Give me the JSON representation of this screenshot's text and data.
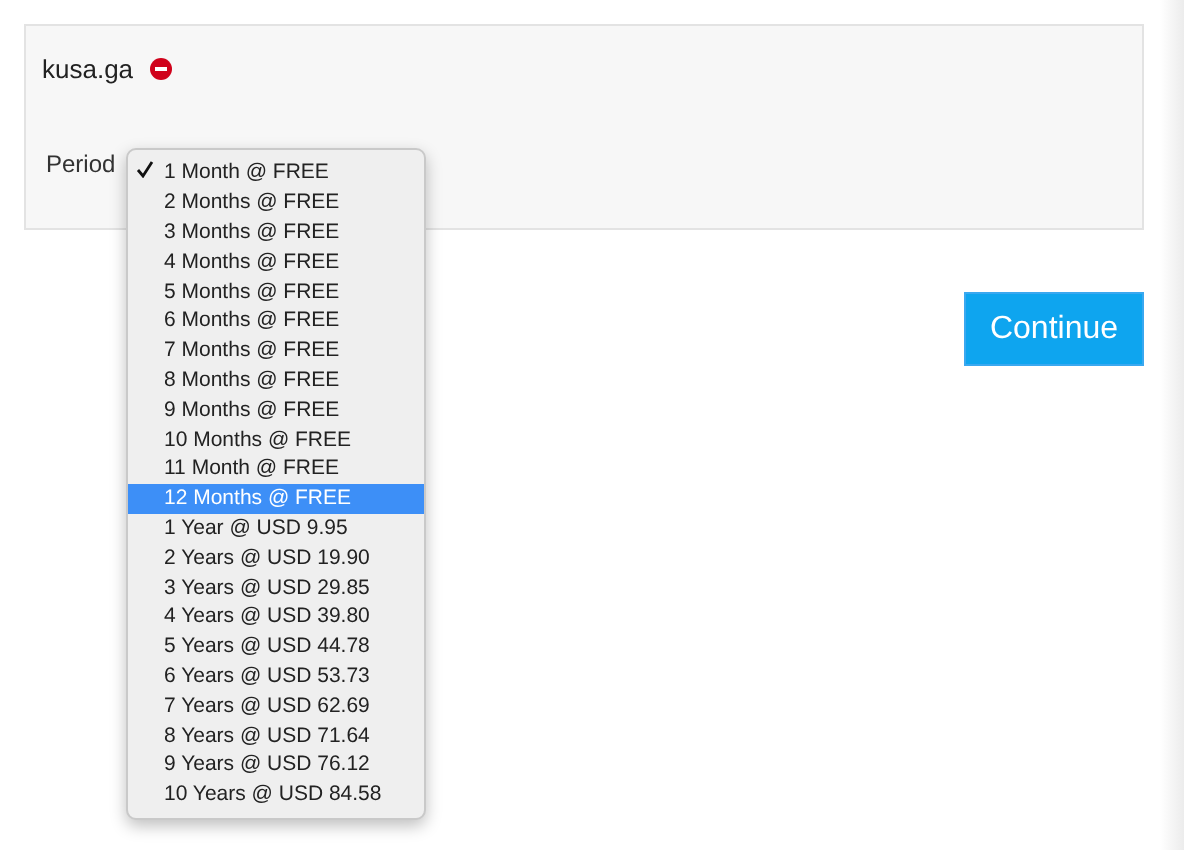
{
  "domain": {
    "name": "kusa.ga"
  },
  "period": {
    "label": "Period",
    "options": [
      {
        "label": "1 Month @ FREE",
        "checked": true,
        "selected": false
      },
      {
        "label": "2 Months @ FREE",
        "checked": false,
        "selected": false
      },
      {
        "label": "3 Months @ FREE",
        "checked": false,
        "selected": false
      },
      {
        "label": "4 Months @ FREE",
        "checked": false,
        "selected": false
      },
      {
        "label": "5 Months @ FREE",
        "checked": false,
        "selected": false
      },
      {
        "label": "6 Months @ FREE",
        "checked": false,
        "selected": false
      },
      {
        "label": "7 Months @ FREE",
        "checked": false,
        "selected": false
      },
      {
        "label": "8 Months @ FREE",
        "checked": false,
        "selected": false
      },
      {
        "label": "9 Months @ FREE",
        "checked": false,
        "selected": false
      },
      {
        "label": "10 Months @ FREE",
        "checked": false,
        "selected": false
      },
      {
        "label": "11 Month @ FREE",
        "checked": false,
        "selected": false
      },
      {
        "label": "12 Months @ FREE",
        "checked": false,
        "selected": true
      },
      {
        "label": "1 Year @ USD 9.95",
        "checked": false,
        "selected": false
      },
      {
        "label": "2 Years @ USD 19.90",
        "checked": false,
        "selected": false
      },
      {
        "label": "3 Years @ USD 29.85",
        "checked": false,
        "selected": false
      },
      {
        "label": "4 Years @ USD 39.80",
        "checked": false,
        "selected": false
      },
      {
        "label": "5 Years @ USD 44.78",
        "checked": false,
        "selected": false
      },
      {
        "label": "6 Years @ USD 53.73",
        "checked": false,
        "selected": false
      },
      {
        "label": "7 Years @ USD 62.69",
        "checked": false,
        "selected": false
      },
      {
        "label": "8 Years @ USD 71.64",
        "checked": false,
        "selected": false
      },
      {
        "label": "9 Years @ USD 76.12",
        "checked": false,
        "selected": false
      },
      {
        "label": "10 Years @ USD 84.58",
        "checked": false,
        "selected": false
      }
    ]
  },
  "continue_button": "Continue"
}
